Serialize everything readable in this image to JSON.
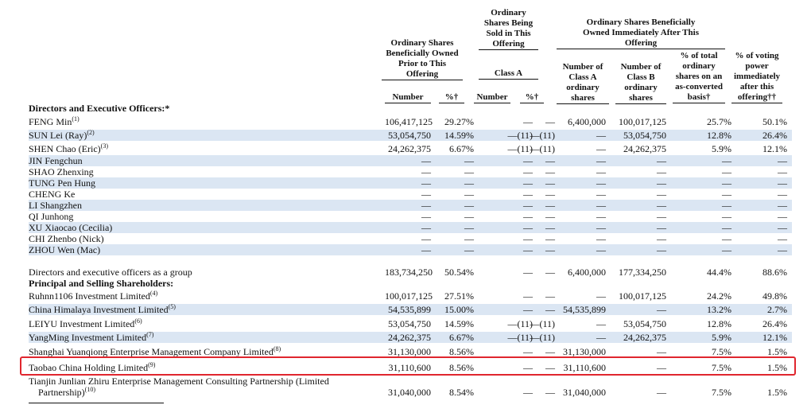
{
  "headers": {
    "prior_group": "Ordinary Shares Beneficially Owned Prior to This Offering",
    "sold_group": "Ordinary Shares Being Sold in This Offering",
    "after_group": "Ordinary Shares Beneficially Owned Immediately After This Offering",
    "class_a_sub": "Class A",
    "number1": "Number",
    "pct1": "%†",
    "number2": "Number",
    "pct2": "%†",
    "class_a_col": "Number of Class A ordinary shares",
    "class_b_col": "Number of Class B ordinary shares",
    "total_pct_col": "% of total ordinary shares on an as-converted basis†",
    "voting_col": "% of voting power immediately after this offering††"
  },
  "rows": [
    {
      "type": "section",
      "label": "Directors and Executive Officers:*"
    },
    {
      "label": "FENG Min",
      "sup": "(1)",
      "n": "106,417,125",
      "p": "29.27%",
      "sn": "—",
      "sp": "—",
      "a": "6,400,000",
      "b": "100,017,125",
      "t": "25.7%",
      "v": "50.1%"
    },
    {
      "label": "SUN Lei (Ray)",
      "sup": "(2)",
      "n": "53,054,750",
      "p": "14.59%",
      "sn": "—(11)",
      "sp": "—(11)",
      "a": "—",
      "b": "53,054,750",
      "t": "12.8%",
      "v": "26.4%"
    },
    {
      "label": "SHEN Chao (Eric)",
      "sup": "(3)",
      "n": "24,262,375",
      "p": "6.67%",
      "sn": "—(11)",
      "sp": "—(11)",
      "a": "—",
      "b": "24,262,375",
      "t": "5.9%",
      "v": "12.1%"
    },
    {
      "label": "JIN Fengchun",
      "sup": "",
      "n": "—",
      "p": "—",
      "sn": "—",
      "sp": "—",
      "a": "—",
      "b": "—",
      "t": "—",
      "v": "—"
    },
    {
      "label": "SHAO Zhenxing",
      "sup": "",
      "n": "—",
      "p": "—",
      "sn": "—",
      "sp": "—",
      "a": "—",
      "b": "—",
      "t": "—",
      "v": "—"
    },
    {
      "label": "TUNG Pen Hung",
      "sup": "",
      "n": "—",
      "p": "—",
      "sn": "—",
      "sp": "—",
      "a": "—",
      "b": "—",
      "t": "—",
      "v": "—"
    },
    {
      "label": "CHENG Ke",
      "sup": "",
      "n": "—",
      "p": "—",
      "sn": "—",
      "sp": "—",
      "a": "—",
      "b": "—",
      "t": "—",
      "v": "—"
    },
    {
      "label": "LI Shangzhen",
      "sup": "",
      "n": "—",
      "p": "—",
      "sn": "—",
      "sp": "—",
      "a": "—",
      "b": "—",
      "t": "—",
      "v": "—"
    },
    {
      "label": "QI Junhong",
      "sup": "",
      "n": "—",
      "p": "—",
      "sn": "—",
      "sp": "—",
      "a": "—",
      "b": "—",
      "t": "—",
      "v": "—"
    },
    {
      "label": "XU Xiaocao (Cecilia)",
      "sup": "",
      "n": "—",
      "p": "—",
      "sn": "—",
      "sp": "—",
      "a": "—",
      "b": "—",
      "t": "—",
      "v": "—"
    },
    {
      "label": "CHI Zhenbo (Nick)",
      "sup": "",
      "n": "—",
      "p": "—",
      "sn": "—",
      "sp": "—",
      "a": "—",
      "b": "—",
      "t": "—",
      "v": "—"
    },
    {
      "label": "ZHOU Wen (Mac)",
      "sup": "",
      "n": "—",
      "p": "—",
      "sn": "—",
      "sp": "—",
      "a": "—",
      "b": "—",
      "t": "—",
      "v": "—"
    },
    {
      "label": "Directors and executive officers as a group",
      "sup": "",
      "n": "183,734,250",
      "p": "50.54%",
      "sn": "—",
      "sp": "—",
      "a": "6,400,000",
      "b": "177,334,250",
      "t": "44.4%",
      "v": "88.6%"
    },
    {
      "type": "section",
      "label": "Principal and Selling Shareholders:"
    },
    {
      "label": "Ruhnn1106 Investment Limited",
      "sup": "(4)",
      "n": "100,017,125",
      "p": "27.51%",
      "sn": "—",
      "sp": "—",
      "a": "—",
      "b": "100,017,125",
      "t": "24.2%",
      "v": "49.8%"
    },
    {
      "label": "China Himalaya Investment Limited",
      "sup": "(5)",
      "n": "54,535,899",
      "p": "15.00%",
      "sn": "—",
      "sp": "—",
      "a": "54,535,899",
      "b": "—",
      "t": "13.2%",
      "v": "2.7%"
    },
    {
      "label": "LEIYU Investment Limited",
      "sup": "(6)",
      "n": "53,054,750",
      "p": "14.59%",
      "sn": "—(11)",
      "sp": "—(11)",
      "a": "—",
      "b": "53,054,750",
      "t": "12.8%",
      "v": "26.4%"
    },
    {
      "label": "YangMing Investment Limited",
      "sup": "(7)",
      "n": "24,262,375",
      "p": "6.67%",
      "sn": "—(11)",
      "sp": "—(11)",
      "a": "—",
      "b": "24,262,375",
      "t": "5.9%",
      "v": "12.1%"
    },
    {
      "label": "Shanghai Yuanqiong Enterprise Management Company Limited",
      "sup": "(8)",
      "n": "31,130,000",
      "p": "8.56%",
      "sn": "—",
      "sp": "—",
      "a": "31,130,000",
      "b": "—",
      "t": "7.5%",
      "v": "1.5%"
    },
    {
      "label": "Taobao China Holding Limited",
      "sup": "(9)",
      "n": "31,110,600",
      "p": "8.56%",
      "sn": "—",
      "sp": "—",
      "a": "31,110,600",
      "b": "—",
      "t": "7.5%",
      "v": "1.5%"
    },
    {
      "label": "Tianjin Junlian Zhiru Enterprise Management Consulting Partnership (Limited",
      "label2": "Partnership)",
      "sup": "(10)",
      "n": "31,040,000",
      "p": "8.54%",
      "sn": "—",
      "sp": "—",
      "a": "31,040,000",
      "b": "—",
      "t": "7.5%",
      "v": "1.5%"
    }
  ]
}
